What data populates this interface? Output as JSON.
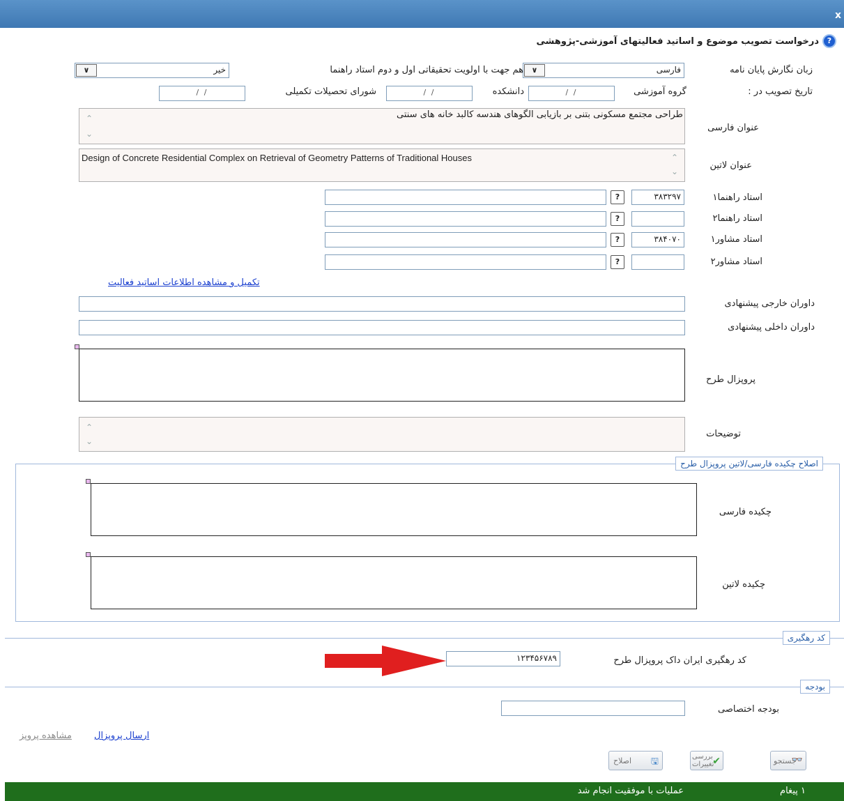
{
  "window": {
    "close_glyph": "x"
  },
  "form": {
    "title": "درخواست تصویب موضوع و اساتید فعالیتهای آموزشی-پژوهشی",
    "help_icon": "?"
  },
  "language": {
    "label": "زبان نگارش پایان نامه",
    "value": "فارسی"
  },
  "priority": {
    "label": "هم جهت با اولویت تحقیقاتی اول و دوم استاد راهنما",
    "value": "خیر"
  },
  "approval_date": {
    "label": "تاریخ تصویب در :",
    "group_label": "گروه آموزشی",
    "faculty_label": "دانشکده",
    "council_label": "شورای تحصیلات تکمیلی",
    "placeholder": "/ /"
  },
  "persian_title": {
    "label": "عنوان فارسی",
    "value": "طراحی مجتمع مسکونی بتنی بر بازیابی الگوهای هندسه کالبد خانه های سنتی"
  },
  "latin_title": {
    "label": "عنوان لاتین",
    "value": "Design of Concrete Residential Complex on Retrieval of Geometry Patterns of Traditional Houses"
  },
  "supervisors": [
    {
      "label": "استاد راهنما۱",
      "code": "۳۸۳۲۹۷",
      "name": ""
    },
    {
      "label": "استاد راهنما۲",
      "code": "",
      "name": ""
    },
    {
      "label": "استاد مشاور۱",
      "code": "۳۸۴۰۷۰",
      "name": ""
    },
    {
      "label": "استاد مشاور۲",
      "code": "",
      "name": ""
    }
  ],
  "lookup_icon": "?",
  "complete_link": "تکمیل و مشاهده اطلاعات اساتید فعالیت",
  "external_referees": {
    "label": "داوران خارجی پیشنهادی",
    "value": ""
  },
  "internal_referees": {
    "label": "داوران داخلی پیشنهادی",
    "value": ""
  },
  "proposal": {
    "label": "پروپزال طرح"
  },
  "notes": {
    "label": "توضیحات"
  },
  "abstract_section": {
    "legend": "اصلاح چکیده فارسی/لاتین پروپزال طرح",
    "persian_label": "چکیده فارسی",
    "latin_label": "چکیده لاتین"
  },
  "tracking": {
    "legend": "کد رهگیری",
    "label": "کد رهگیری ایران داک پروپزال طرح",
    "value": "۱۲۳۴۵۶۷۸۹"
  },
  "budget": {
    "legend": "بودجه",
    "label": "بودجه اختصاصی",
    "value": ""
  },
  "links": {
    "send": "ارسال پروپزال",
    "view": "مشاهده پروپز"
  },
  "toolbar": {
    "search": "جستجو",
    "review_line1": "بررسی",
    "review_line2": "تغییرات",
    "edit": "اصلاح"
  },
  "status": {
    "count": "۱ پیغام",
    "message": "عملیات با موفقیت انجام شد"
  },
  "colors": {
    "accent": "#3f78b3",
    "status_bg": "#1f6e1c",
    "arrow": "#e01f1f",
    "link": "#1a3fcf"
  }
}
